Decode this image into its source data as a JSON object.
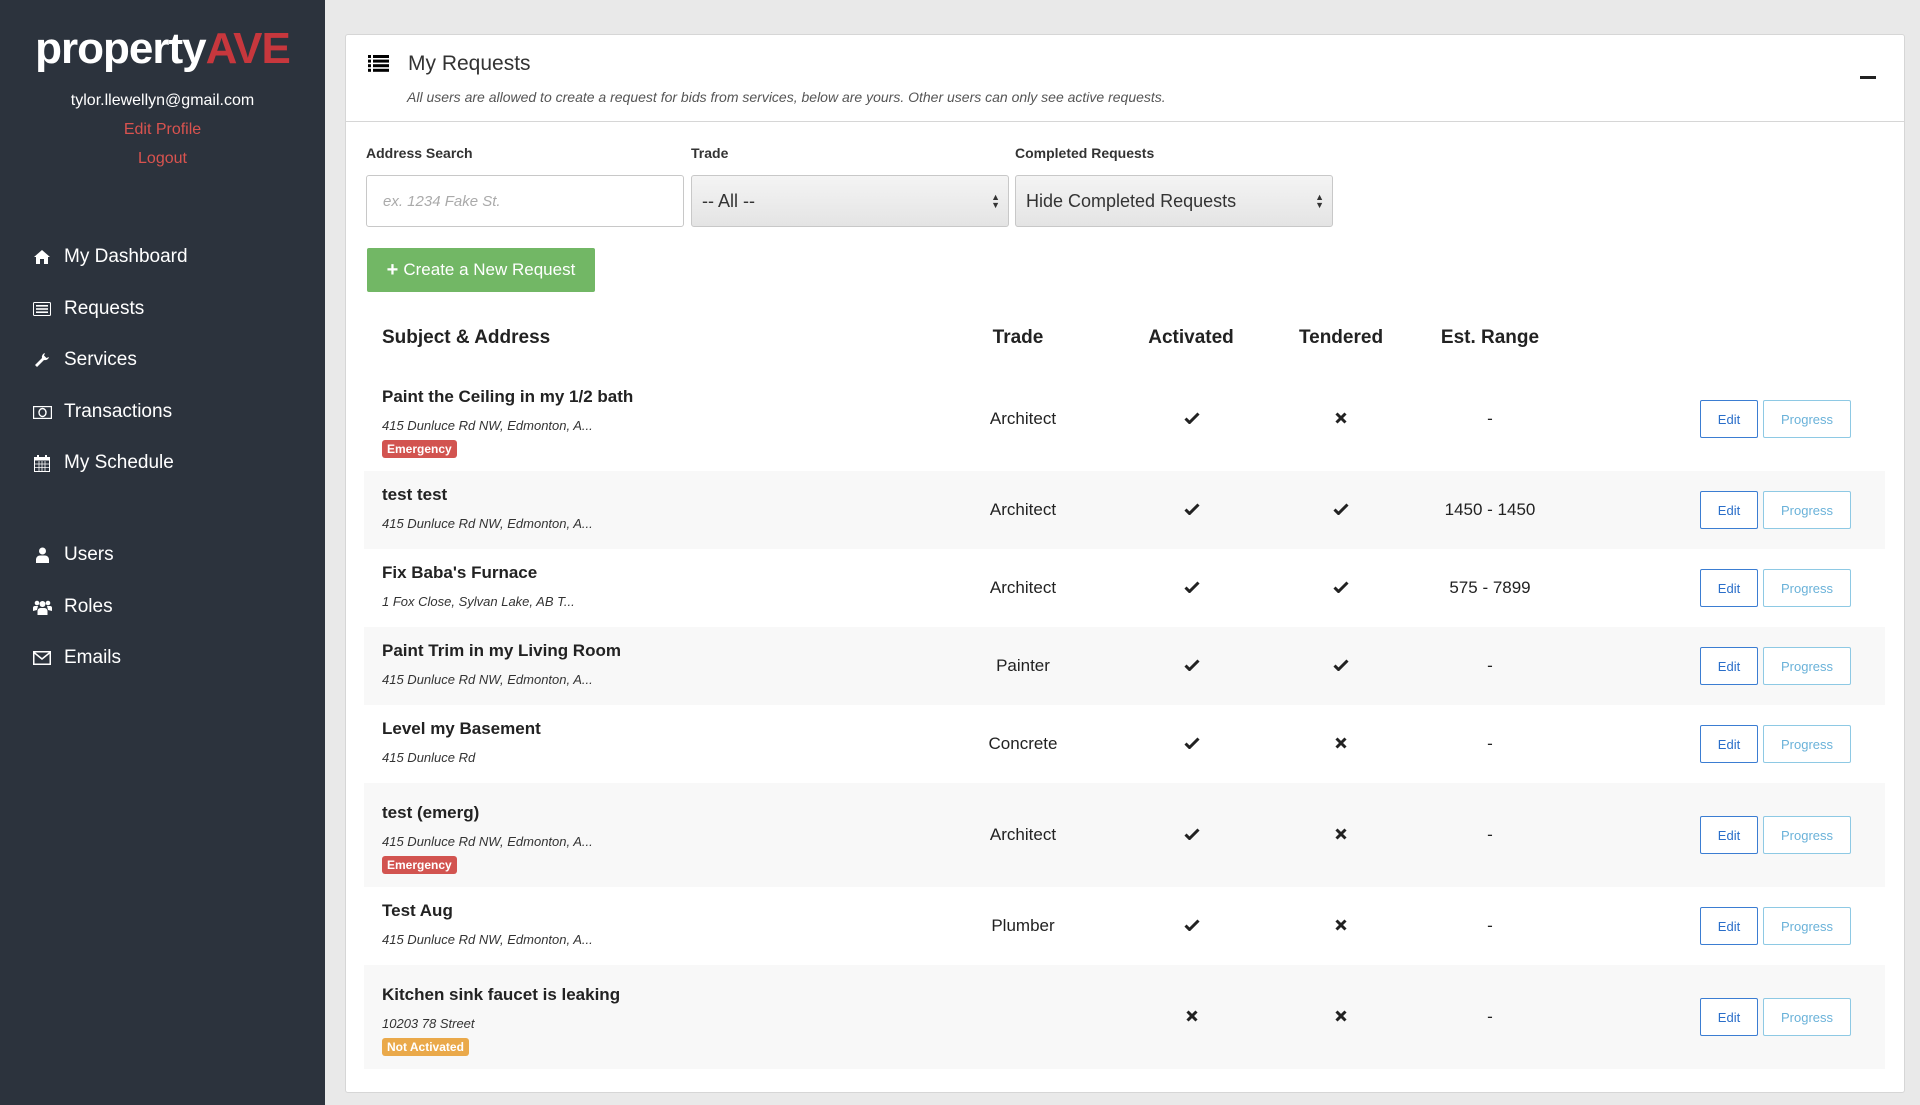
{
  "sidebar": {
    "logo": {
      "part1": "property",
      "part2": "AVE"
    },
    "user_email": "tylor.llewellyn@gmail.com",
    "edit_profile": "Edit Profile",
    "logout": "Logout",
    "nav": [
      {
        "label": "My Dashboard",
        "icon": "home-icon"
      },
      {
        "label": "Requests",
        "icon": "list-alt-icon"
      },
      {
        "label": "Services",
        "icon": "wrench-icon"
      },
      {
        "label": "Transactions",
        "icon": "money-icon"
      },
      {
        "label": "My Schedule",
        "icon": "calendar-icon"
      },
      {
        "label": "Users",
        "icon": "user-icon"
      },
      {
        "label": "Roles",
        "icon": "users-icon"
      },
      {
        "label": "Emails",
        "icon": "envelope-icon"
      }
    ]
  },
  "panel": {
    "title": "My Requests",
    "subtitle": "All users are allowed to create a request for bids from services, below are yours. Other users can only see active requests.",
    "collapse_icon": "minus-icon"
  },
  "filters": {
    "address_label": "Address Search",
    "address_placeholder": "ex. 1234 Fake St.",
    "address_value": "",
    "trade_label": "Trade",
    "trade_value": "-- All --",
    "completed_label": "Completed Requests",
    "completed_value": "Hide Completed Requests"
  },
  "create_button": {
    "icon": "+",
    "label": "Create a New Request"
  },
  "table": {
    "headers": {
      "subject": "Subject & Address",
      "trade": "Trade",
      "activated": "Activated",
      "tendered": "Tendered",
      "range": "Est. Range"
    },
    "edit_label": "Edit",
    "progress_label": "Progress",
    "rows": [
      {
        "subject": "Paint the Ceiling in my 1/2 bath",
        "address": "415 Dunluce Rd NW, Edmonton, A...",
        "badge": "Emergency",
        "badge_type": "emergency",
        "trade": "Architect",
        "activated": true,
        "tendered": false,
        "range": "-"
      },
      {
        "subject": "test test",
        "address": "415 Dunluce Rd NW, Edmonton, A...",
        "badge": "",
        "badge_type": "",
        "trade": "Architect",
        "activated": true,
        "tendered": true,
        "range": "1450 - 1450"
      },
      {
        "subject": "Fix Baba's Furnace",
        "address": "1 Fox Close, Sylvan Lake, AB T...",
        "badge": "",
        "badge_type": "",
        "trade": "Architect",
        "activated": true,
        "tendered": true,
        "range": "575 - 7899"
      },
      {
        "subject": "Paint Trim in my Living Room",
        "address": "415 Dunluce Rd NW, Edmonton, A...",
        "badge": "",
        "badge_type": "",
        "trade": "Painter",
        "activated": true,
        "tendered": true,
        "range": "-"
      },
      {
        "subject": "Level my Basement",
        "address": "415 Dunluce Rd",
        "badge": "",
        "badge_type": "",
        "trade": "Concrete",
        "activated": true,
        "tendered": false,
        "range": "-"
      },
      {
        "subject": "test (emerg)",
        "address": "415 Dunluce Rd NW, Edmonton, A...",
        "badge": "Emergency",
        "badge_type": "emergency",
        "trade": "Architect",
        "activated": true,
        "tendered": false,
        "range": "-"
      },
      {
        "subject": "Test Aug",
        "address": "415 Dunluce Rd NW, Edmonton, A...",
        "badge": "",
        "badge_type": "",
        "trade": "Plumber",
        "activated": true,
        "tendered": false,
        "range": "-"
      },
      {
        "subject": "Kitchen sink faucet is leaking",
        "address": "10203 78 Street",
        "badge": "Not Activated",
        "badge_type": "notact",
        "trade": "",
        "activated": false,
        "tendered": false,
        "range": "-"
      }
    ]
  },
  "colors": {
    "sidebar_bg": "#2c333d",
    "brand_red": "#c7373d",
    "link_red": "#d9534f",
    "create_green": "#72b765",
    "emergency_badge": "#d25450",
    "not_activated_badge": "#eaa94a",
    "edit_blue": "#2a6ec9",
    "progress_blue": "#6ab2d9"
  }
}
